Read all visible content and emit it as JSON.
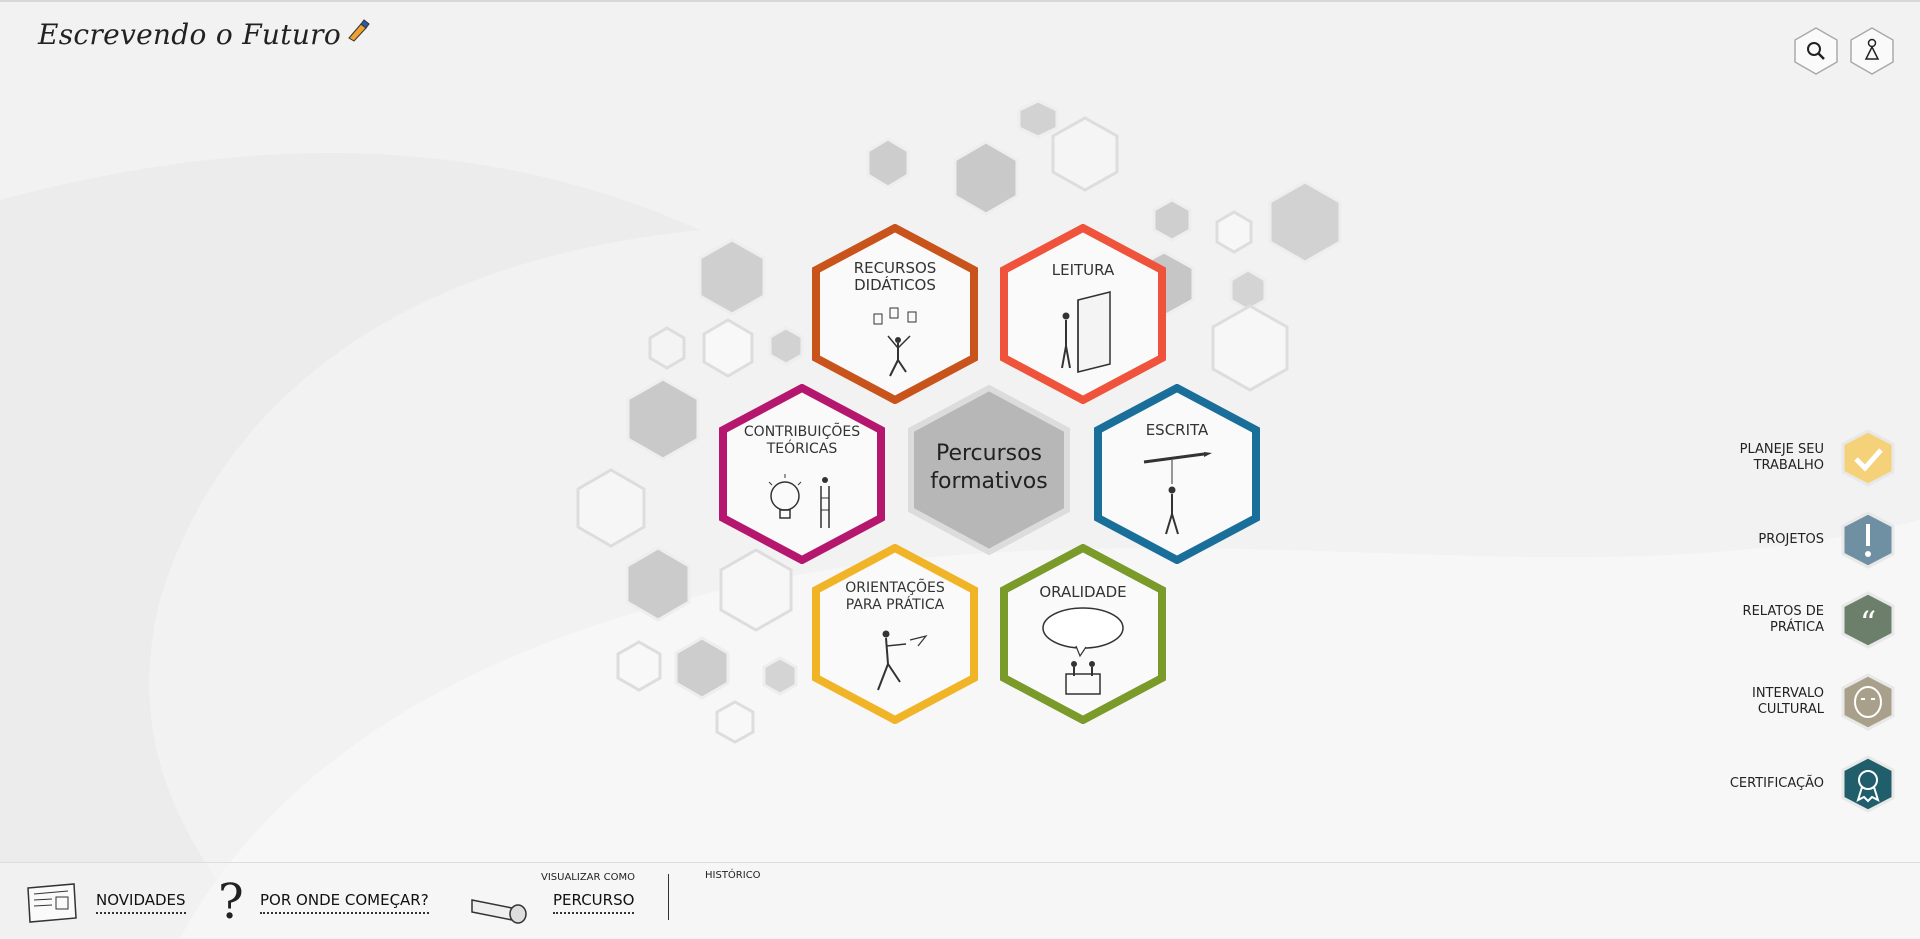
{
  "app": {
    "logo_text": "Escrevendo o Futuro"
  },
  "header": {
    "search_icon": "search-icon",
    "user_icon": "user-icon"
  },
  "main": {
    "center": {
      "line1": "Percursos",
      "line2": "formativos"
    },
    "modules": [
      {
        "line1": "Recursos",
        "line2": "didáticos",
        "color": "#c8541c"
      },
      {
        "line1": "Leitura",
        "line2": "",
        "color": "#f0533c"
      },
      {
        "line1": "Contribuições",
        "line2": "teóricas",
        "color": "#b5176f"
      },
      {
        "line1": "Escrita",
        "line2": "",
        "color": "#1a6f9a"
      },
      {
        "line1": "Orientações",
        "line2": "para prática",
        "color": "#f0b426"
      },
      {
        "line1": "Oralidade",
        "line2": "",
        "color": "#7a9a2a"
      }
    ]
  },
  "sidebar": {
    "items": [
      {
        "line1": "Planeje seu",
        "line2": "trabalho",
        "color": "#f5d27a",
        "icon": "check-icon"
      },
      {
        "line1": "Projetos",
        "line2": "",
        "color": "#6f8fa3",
        "icon": "exclamation-icon"
      },
      {
        "line1": "Relatos de",
        "line2": "prática",
        "color": "#6c7f6a",
        "icon": "quote-icon"
      },
      {
        "line1": "Intervalo",
        "line2": "cultural",
        "color": "#a8a08a",
        "icon": "mask-icon"
      },
      {
        "line1": "Certificação",
        "line2": "",
        "color": "#1f5e6a",
        "icon": "ribbon-icon"
      }
    ]
  },
  "footer": {
    "news": "Novidades",
    "start": "Por onde começar?",
    "view_as": "Visualizar como",
    "path": "Percurso",
    "history": "Histórico"
  }
}
